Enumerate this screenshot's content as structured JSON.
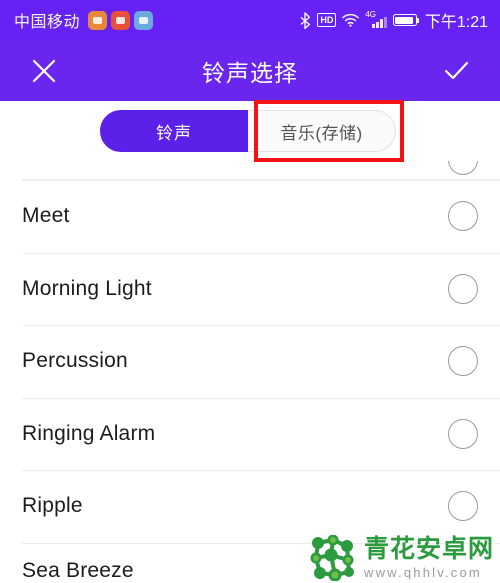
{
  "status_bar": {
    "carrier": "中国移动",
    "app_icons": [
      "notification-icon-orange",
      "notification-icon-red",
      "notification-icon-blue"
    ],
    "bluetooth_icon": "bluetooth-icon",
    "hd_label": "HD",
    "wifi_icon": "wifi-icon",
    "network_label": "4G",
    "battery_icon": "battery-icon",
    "time": "下午1:21"
  },
  "app_bar": {
    "close_icon": "close-icon",
    "title": "铃声选择",
    "confirm_icon": "check-icon",
    "background_color": "#6A26EE"
  },
  "tabs": {
    "items": [
      {
        "label": "铃声",
        "selected": true
      },
      {
        "label": "音乐(存储)",
        "selected": false
      }
    ],
    "selected_color": "#5B21E8",
    "highlight_color": "#F21414"
  },
  "ringtone_list": {
    "rows": [
      {
        "label": "",
        "selected": false,
        "partial": "top"
      },
      {
        "label": "Meet",
        "selected": false
      },
      {
        "label": "Morning Light",
        "selected": false
      },
      {
        "label": "Percussion",
        "selected": false
      },
      {
        "label": "Ringing Alarm",
        "selected": false
      },
      {
        "label": "Ripple",
        "selected": false
      },
      {
        "label": "Sea Breeze",
        "selected": false,
        "partial": "bottom"
      }
    ]
  },
  "watermark": {
    "title": "青花安卓网",
    "url": "www.qhhlv.com",
    "logo_icon": "molecule-logo-icon",
    "color": "#2C9A3E"
  }
}
